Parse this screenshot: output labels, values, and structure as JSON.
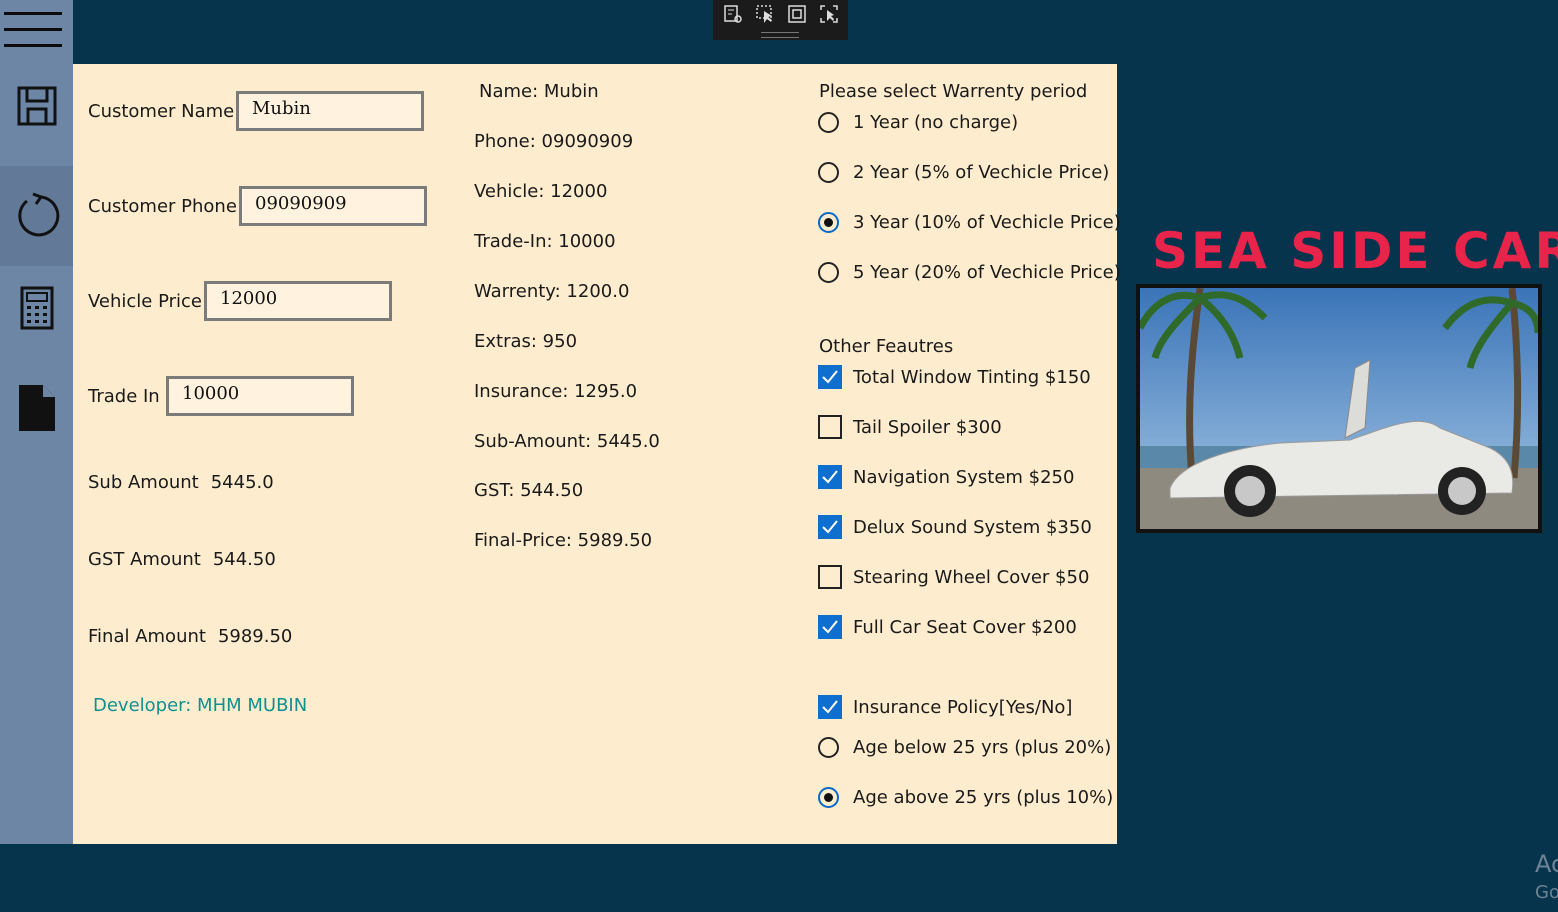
{
  "nav": {
    "icons": [
      "hamburger-icon",
      "save-icon",
      "refresh-icon",
      "calculator-icon",
      "document-icon"
    ]
  },
  "form": {
    "customer_name_label": "Customer Name",
    "customer_name_value": "Mubin",
    "customer_phone_label": "Customer Phone",
    "customer_phone_value": "09090909",
    "vehicle_price_label": "Vehicle Price",
    "vehicle_price_value": "12000",
    "trade_in_label": "Trade In",
    "trade_in_value": "10000",
    "sub_amount_label": "Sub Amount",
    "sub_amount_value": "5445.0",
    "gst_amount_label": "GST Amount",
    "gst_amount_value": "544.50",
    "final_amount_label": "Final Amount",
    "final_amount_value": "5989.50",
    "developer": "Developer: MHM MUBIN"
  },
  "receipt": {
    "lines": [
      "Name: Mubin",
      "Phone: 09090909",
      "Vehicle: 12000",
      "Trade-In: 10000",
      "Warrenty: 1200.0",
      "Extras: 950",
      "Insurance: 1295.0",
      "Sub-Amount: 5445.0",
      "GST: 544.50",
      "Final-Price: 5989.50"
    ]
  },
  "warranty": {
    "title": "Please select Warrenty period",
    "options": [
      {
        "label": "1 Year (no charge)",
        "selected": false
      },
      {
        "label": "2 Year (5% of Vechicle Price)",
        "selected": false
      },
      {
        "label": "3 Year (10% of Vechicle Price)",
        "selected": true
      },
      {
        "label": "5 Year (20% of Vechicle Price)",
        "selected": false
      }
    ]
  },
  "features": {
    "title": "Other Feautres",
    "items": [
      {
        "label": "Total Window Tinting $150",
        "checked": true
      },
      {
        "label": "Tail Spoiler $300",
        "checked": false
      },
      {
        "label": "Navigation System $250",
        "checked": true
      },
      {
        "label": "Delux Sound System $350",
        "checked": true
      },
      {
        "label": "Stearing Wheel Cover $50",
        "checked": false
      },
      {
        "label": "Full Car Seat Cover $200",
        "checked": true
      }
    ]
  },
  "insurance": {
    "label": "Insurance Policy[Yes/No]",
    "checked": true,
    "options": [
      {
        "label": "Age below 25 yrs (plus 20%)",
        "selected": false
      },
      {
        "label": "Age above 25 yrs (plus 10%)",
        "selected": true
      }
    ]
  },
  "brand": {
    "title": "SEA SIDE CAR"
  },
  "watermark": {
    "line1": "Ac",
    "line2": "Go"
  },
  "colors": {
    "background": "#06344c",
    "panel": "#fdecce",
    "nav": "#6d86a6",
    "accent": "#0f6fcf",
    "brand": "#e8244a",
    "developer": "#119090"
  }
}
